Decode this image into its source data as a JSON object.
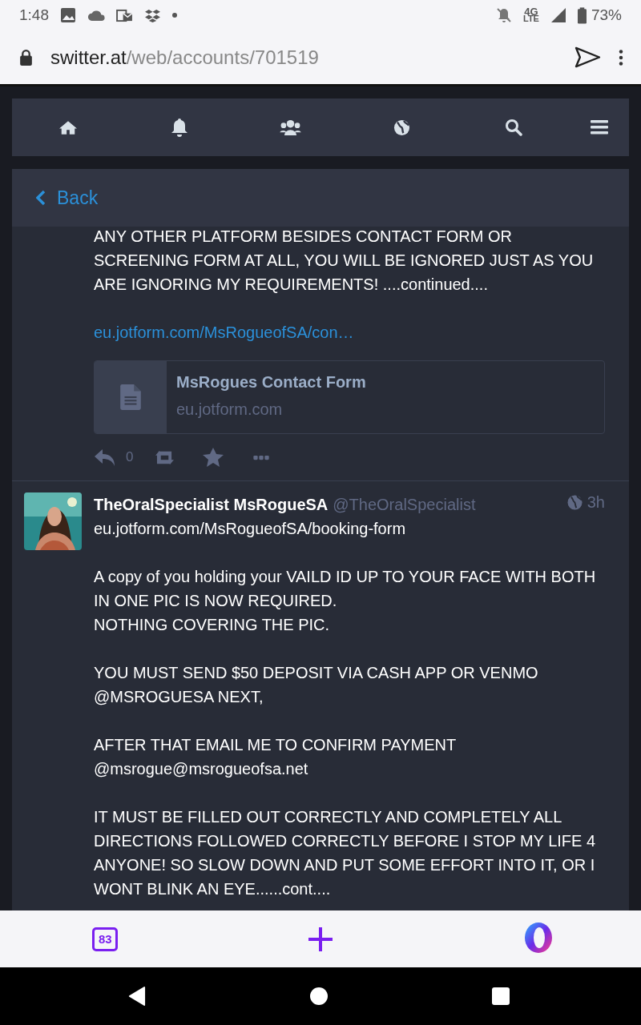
{
  "status_bar": {
    "time": "1:48",
    "network": "4G",
    "network_sub": "LTE",
    "battery": "73%"
  },
  "browser": {
    "domain": "switter.at",
    "path": "/web/accounts/701519"
  },
  "back": {
    "label": "Back"
  },
  "posts": [
    {
      "kind": "continued",
      "paragraphs": [
        "ANY OTHER PLATFORM BESIDES CONTACT FORM OR SCREENING FORM AT ALL, YOU WILL BE IGNORED JUST AS YOU ARE IGNORING MY REQUIREMENTS! ....continued...."
      ],
      "link": "eu.jotform.com/MsRogueofSA/con…",
      "card": {
        "title": "MsRogues Contact Form",
        "domain": "eu.jotform.com"
      },
      "reply_count": "0"
    },
    {
      "kind": "full",
      "display_name": "TheOralSpecialist MsRogueSA",
      "handle": "@TheOralSpecialist",
      "time": "3h",
      "paragraphs": [
        "eu.jotform.com/MsRogueofSA/booking-form",
        "A copy of you holding your VAILD ID UP TO YOUR FACE WITH BOTH IN ONE PIC IS NOW REQUIRED.\nNOTHING COVERING THE PIC.",
        "YOU MUST SEND $50 DEPOSIT VIA CASH APP OR VENMO @MSROGUESA NEXT,",
        "AFTER THAT EMAIL ME TO CONFIRM PAYMENT @msrogue@msrogueofsa.net",
        "IT MUST BE FILLED OUT CORRECTLY AND COMPLETELY ALL DIRECTIONS FOLLOWED CORRECTLY BEFORE I STOP MY LIFE 4 ANYONE! SO SLOW DOWN AND PUT SOME EFFORT INTO IT, OR I WONT BLINK AN EYE......cont...."
      ]
    }
  ],
  "bottom_bar": {
    "tabs_count": "83"
  }
}
